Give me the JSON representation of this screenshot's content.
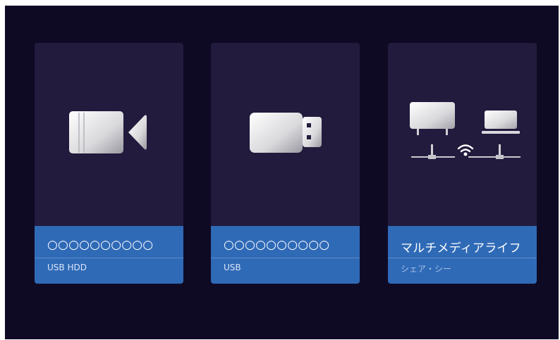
{
  "cards": [
    {
      "title": "○○○○○○○○○○",
      "subtitle": "USB HDD",
      "icon": "video-camera-icon"
    },
    {
      "title": "○○○○○○○○○○",
      "subtitle": "USB",
      "icon": "usb-drive-icon"
    },
    {
      "title": "マルチメディアライフ",
      "subtitle": "シェア・シー",
      "icon": "network-share-icon"
    }
  ],
  "colors": {
    "background": "#0f0a24",
    "card": "#221b3d",
    "label": "#2f6ab7"
  }
}
